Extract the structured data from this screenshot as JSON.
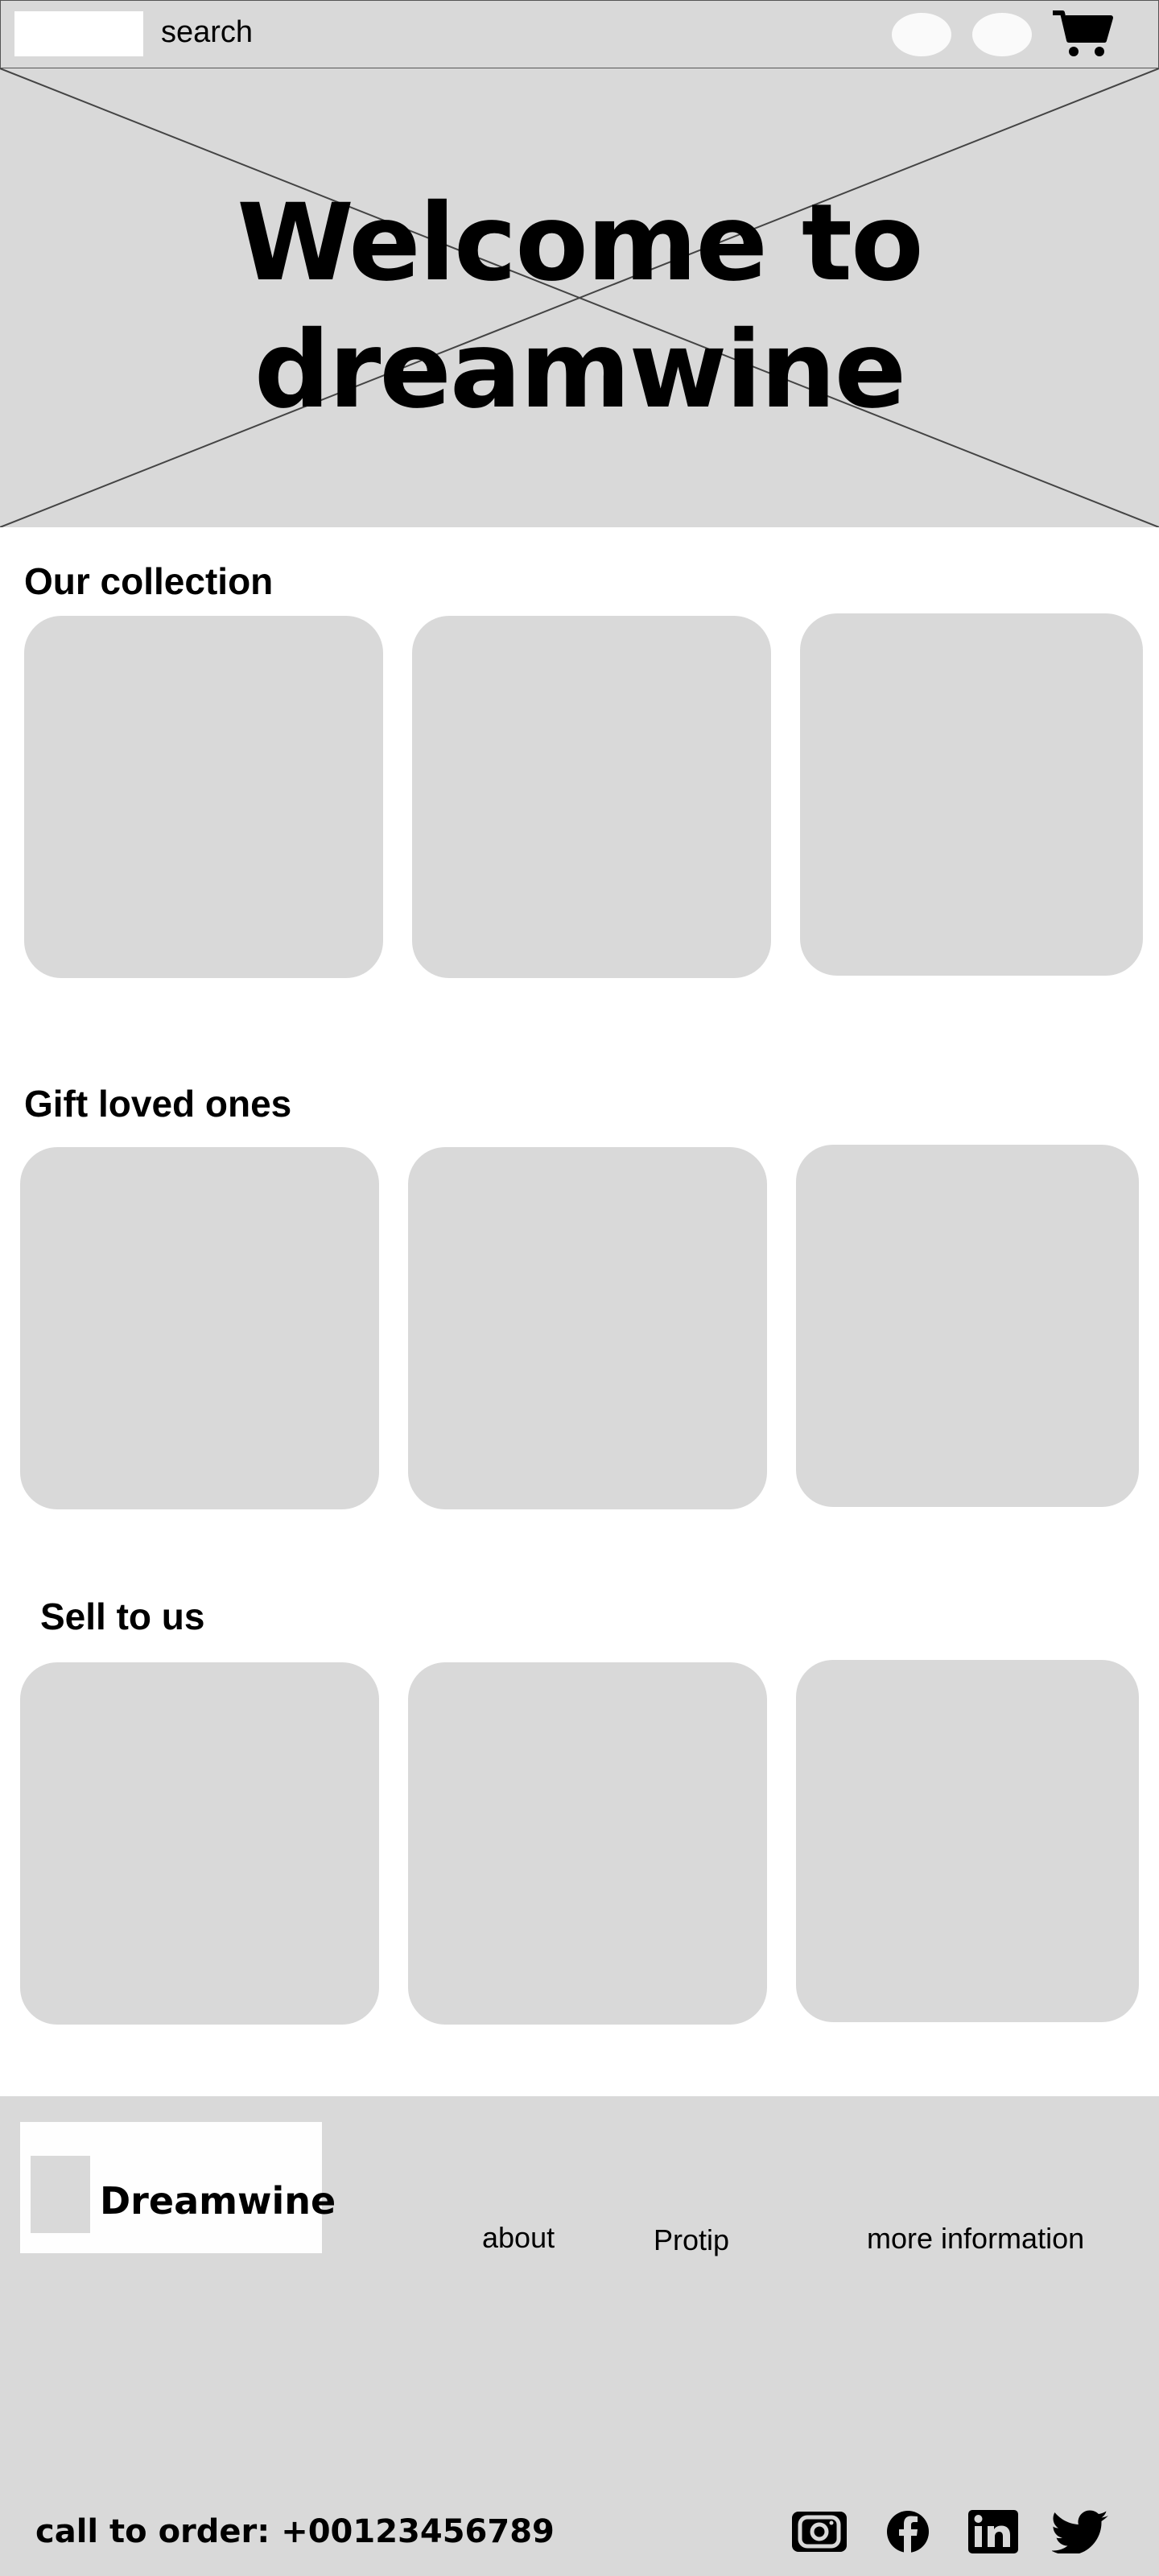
{
  "header": {
    "search_label": "search",
    "cart_icon": "cart-icon"
  },
  "hero": {
    "title_line1": "Welcome to",
    "title_line2": "dreamwine"
  },
  "sections": [
    {
      "title": "Our collection"
    },
    {
      "title": "Gift loved ones"
    },
    {
      "title": "Sell to us"
    }
  ],
  "footer": {
    "brand": "Dreamwine",
    "links": [
      "about",
      "Protip",
      "more information"
    ],
    "call_to_order": "call to order: +00123456789",
    "social_icons": [
      "instagram-icon",
      "facebook-icon",
      "linkedin-icon",
      "twitter-icon"
    ]
  },
  "colors": {
    "placeholder_gray": "#d9d9d9",
    "background": "#ffffff"
  }
}
